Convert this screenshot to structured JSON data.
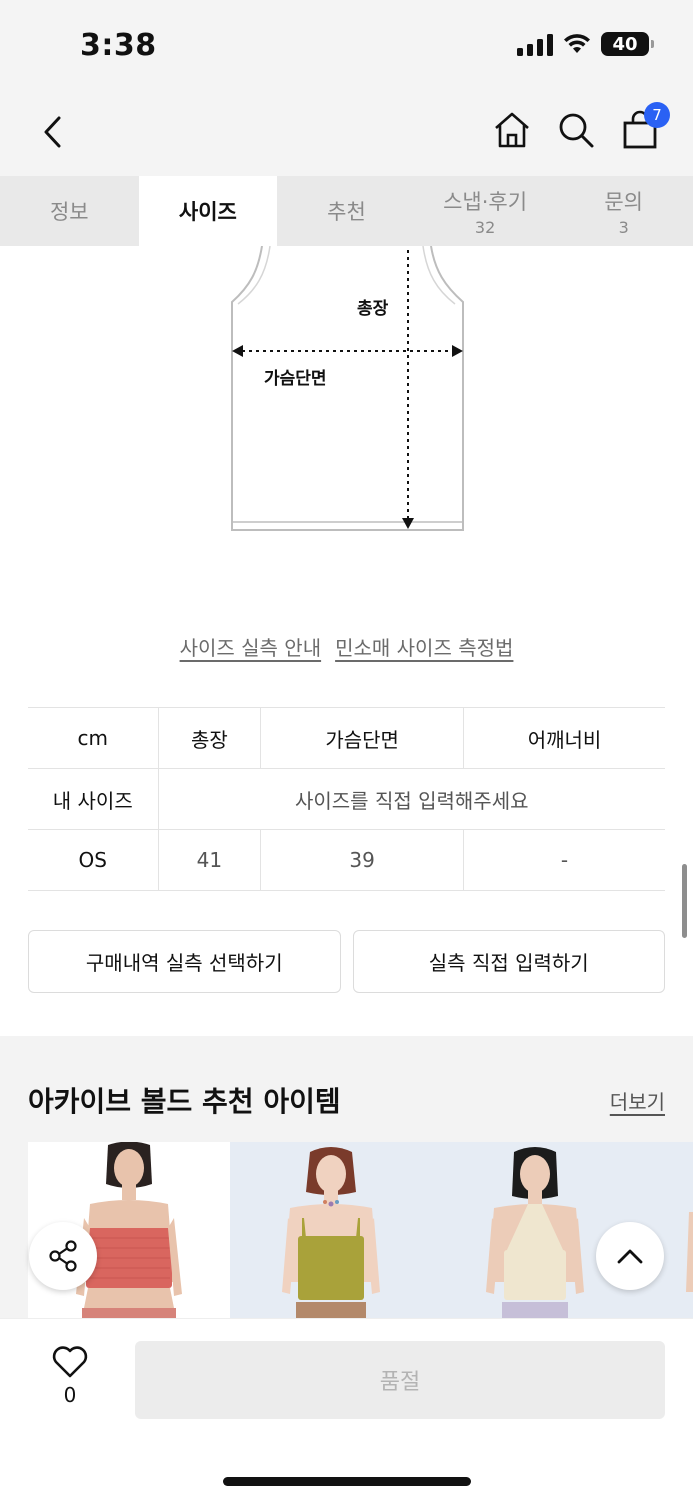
{
  "status_bar": {
    "time": "3:38",
    "battery": "40"
  },
  "header": {
    "cart_count": "7"
  },
  "tabs": [
    {
      "label": "정보",
      "count": ""
    },
    {
      "label": "사이즈",
      "count": ""
    },
    {
      "label": "추천",
      "count": ""
    },
    {
      "label": "스냅·후기",
      "count": "32"
    },
    {
      "label": "문의",
      "count": "3"
    }
  ],
  "diagram": {
    "length_label": "총장",
    "chest_label": "가슴단면"
  },
  "links": {
    "measure_guide": "사이즈 실측 안내",
    "sleeveless_guide": "민소매 사이즈 측정법"
  },
  "size_table": {
    "unit": "cm",
    "columns": [
      "총장",
      "가슴단면",
      "어깨너비"
    ],
    "my_size_label": "내 사이즈",
    "my_size_prompt": "사이즈를 직접 입력해주세요",
    "rows": [
      {
        "size": "OS",
        "values": [
          "41",
          "39",
          "-"
        ]
      }
    ]
  },
  "buttons": {
    "purchase_history": "구매내역 실측 선택하기",
    "direct_input": "실측 직접 입력하기"
  },
  "recommend": {
    "title": "아카이브 볼드 추천 아이템",
    "more": "더보기"
  },
  "bottom_bar": {
    "like_count": "0",
    "soldout_label": "품절"
  },
  "colors": {
    "accent_badge": "#2a61f4",
    "item1_top": "#d9665f",
    "item2_top": "#a9a23a",
    "item3_top": "#efe6cf"
  }
}
